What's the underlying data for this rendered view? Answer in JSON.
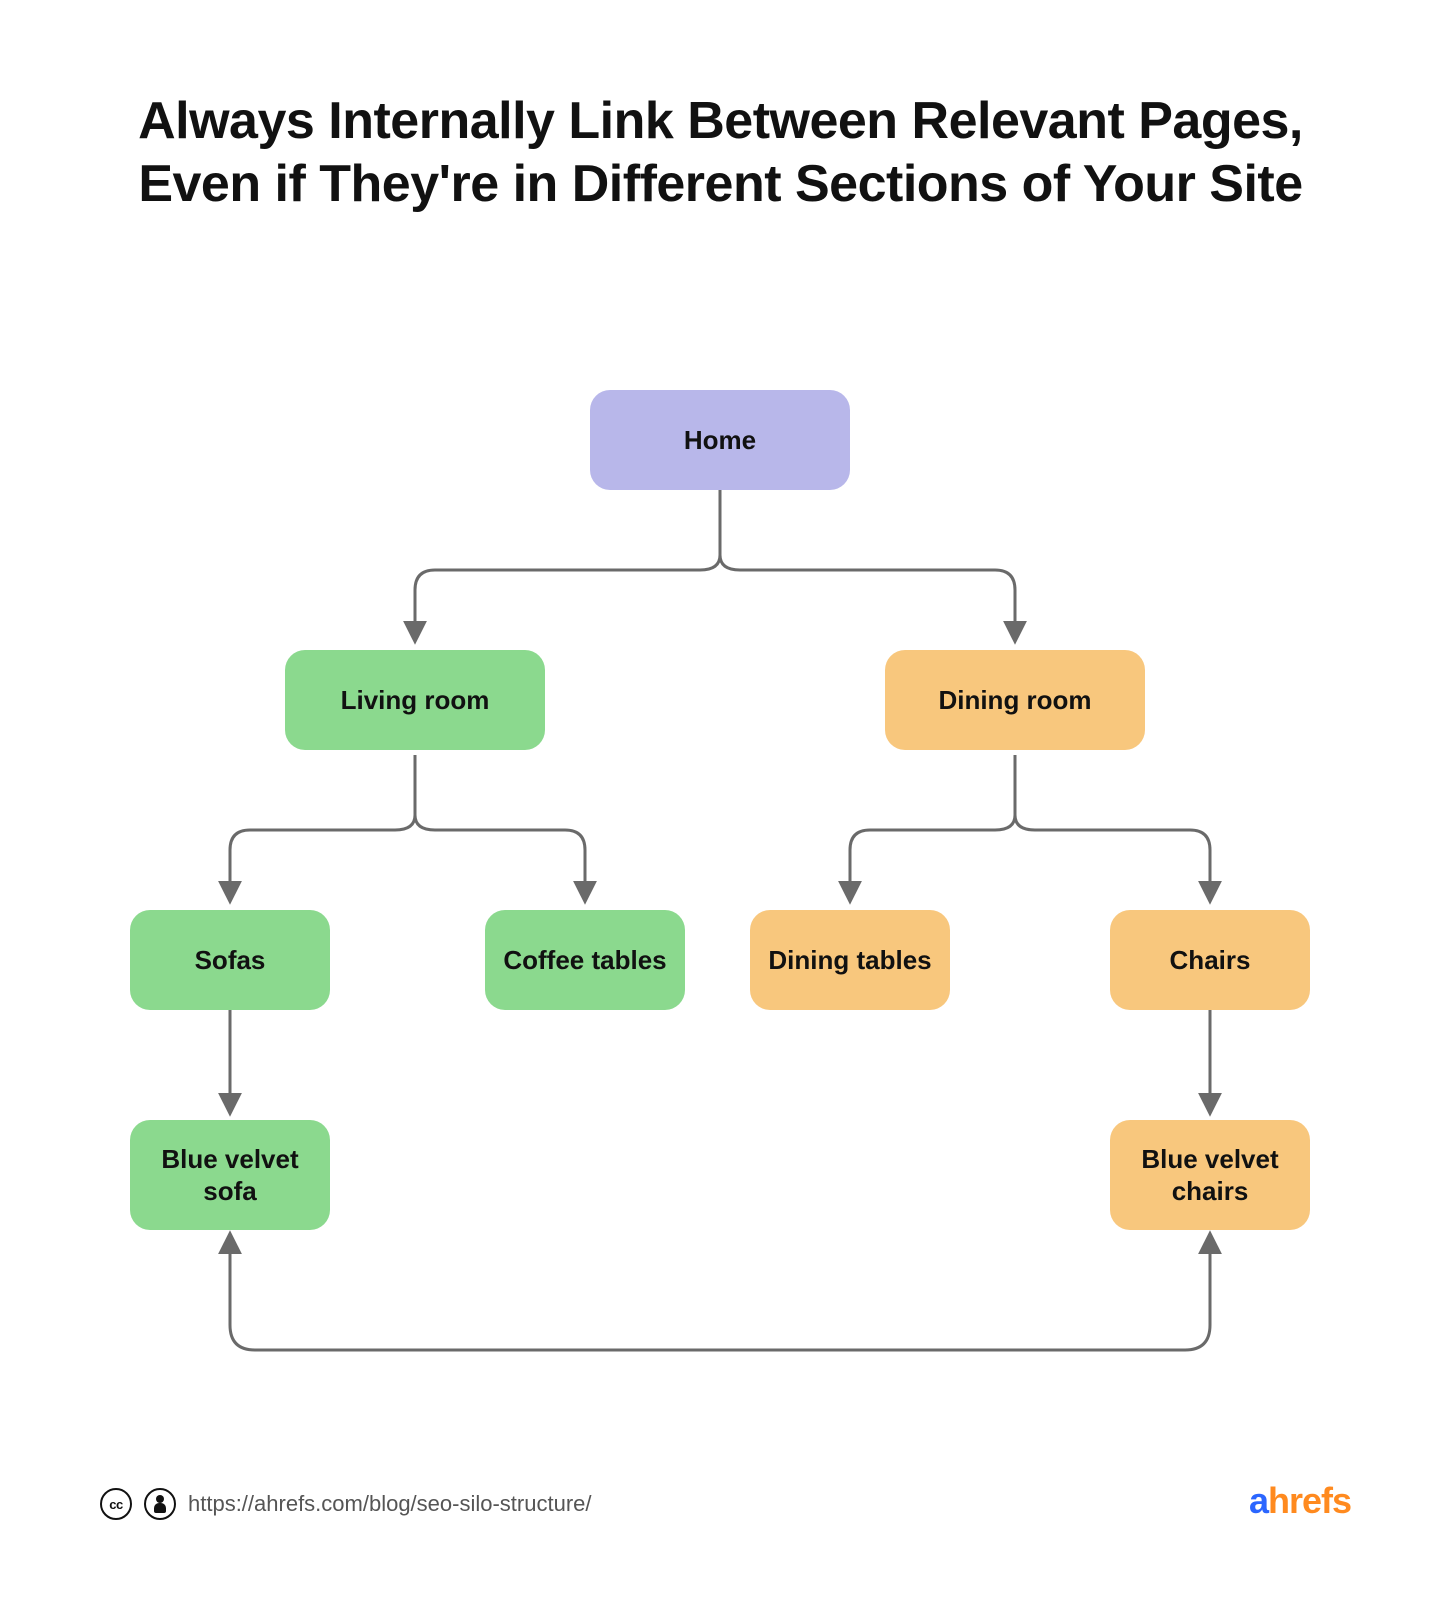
{
  "title": "Always Internally Link Between Relevant Pages, Even if They're in Different Sections of Your Site",
  "nodes": {
    "home": "Home",
    "living_room": "Living room",
    "dining_room": "Dining room",
    "sofas": "Sofas",
    "coffee_tables": "Coffee tables",
    "dining_tables": "Dining tables",
    "chairs": "Chairs",
    "blue_velvet_sofa": "Blue velvet sofa",
    "blue_velvet_chairs": "Blue velvet chairs"
  },
  "colors": {
    "home": "#b8b7ea",
    "green": "#8bd98e",
    "orange": "#f8c77d",
    "arrow": "#6a6a6a"
  },
  "footer": {
    "url": "https://ahrefs.com/blog/seo-silo-structure/",
    "cc_text": "cc",
    "brand_a": "a",
    "brand_rest": "hrefs"
  },
  "chart_data": {
    "type": "tree-diagram",
    "description": "Site hierarchy showing internal linking across silos",
    "nodes": [
      {
        "id": "home",
        "label": "Home",
        "color": "purple"
      },
      {
        "id": "living_room",
        "label": "Living room",
        "color": "green",
        "parent": "home"
      },
      {
        "id": "dining_room",
        "label": "Dining room",
        "color": "orange",
        "parent": "home"
      },
      {
        "id": "sofas",
        "label": "Sofas",
        "color": "green",
        "parent": "living_room"
      },
      {
        "id": "coffee_tables",
        "label": "Coffee tables",
        "color": "green",
        "parent": "living_room"
      },
      {
        "id": "dining_tables",
        "label": "Dining tables",
        "color": "orange",
        "parent": "dining_room"
      },
      {
        "id": "chairs",
        "label": "Chairs",
        "color": "orange",
        "parent": "dining_room"
      },
      {
        "id": "blue_velvet_sofa",
        "label": "Blue velvet sofa",
        "color": "green",
        "parent": "sofas"
      },
      {
        "id": "blue_velvet_chairs",
        "label": "Blue velvet chairs",
        "color": "orange",
        "parent": "chairs"
      }
    ],
    "cross_links": [
      {
        "from": "blue_velvet_sofa",
        "to": "blue_velvet_chairs",
        "bidirectional": true
      }
    ]
  }
}
